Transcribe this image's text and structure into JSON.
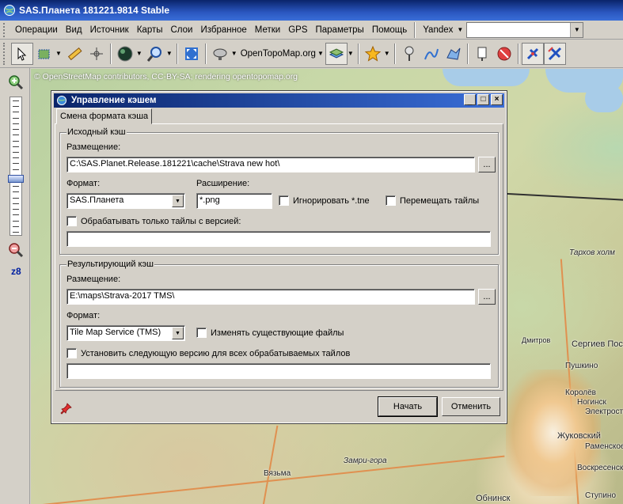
{
  "app": {
    "title": "SAS.Планета 181221.9814 Stable"
  },
  "menu": {
    "items": [
      "Операции",
      "Вид",
      "Источник",
      "Карты",
      "Слои",
      "Избранное",
      "Метки",
      "GPS",
      "Параметры",
      "Помощь"
    ],
    "search_provider": "Yandex",
    "search_value": ""
  },
  "toolbar": {
    "map_name": "OpenTopoMap.org"
  },
  "zoom": {
    "level_label": "z8",
    "level_fraction": 0.6
  },
  "map": {
    "attribution": "© OpenStreetMap contributors, CC-BY-SA; rendering opentopomap.org",
    "places": [
      "Тархов холм",
      "Сергиев Посад",
      "Пушкино",
      "Королёв",
      "Ногинск",
      "Электросталь",
      "Жуковский",
      "Раменское",
      "Воскресенск",
      "Вязьма",
      "Замри-гора",
      "Обнинск",
      "Ступино",
      "Дмитров"
    ]
  },
  "dialog": {
    "title": "Управление кэшем",
    "tab_label": "Смена формата кэша",
    "source": {
      "group_label": "Исходный кэш",
      "location_label": "Размещение:",
      "location_value": "C:\\SAS.Planet.Release.181221\\cache\\Strava new hot\\",
      "browse_label": "...",
      "format_label": "Формат:",
      "format_value": "SAS.Планета",
      "extension_label": "Расширение:",
      "extension_value": "*.png",
      "ignore_tne_label": "Игнорировать *.tne",
      "move_tiles_label": "Перемещать тайлы",
      "only_version_label": "Обрабатывать только тайлы с версией:",
      "version_value": ""
    },
    "target": {
      "group_label": "Результирующий кэш",
      "location_label": "Размещение:",
      "location_value": "E:\\maps\\Strava-2017 TMS\\",
      "browse_label": "...",
      "format_label": "Формат:",
      "format_value": "Tile Map Service (TMS)",
      "overwrite_label": "Изменять существующие файлы",
      "set_version_label": "Установить следующую версию для всех обрабатываемых тайлов",
      "version_value": ""
    },
    "start_label": "Начать",
    "cancel_label": "Отменить"
  }
}
